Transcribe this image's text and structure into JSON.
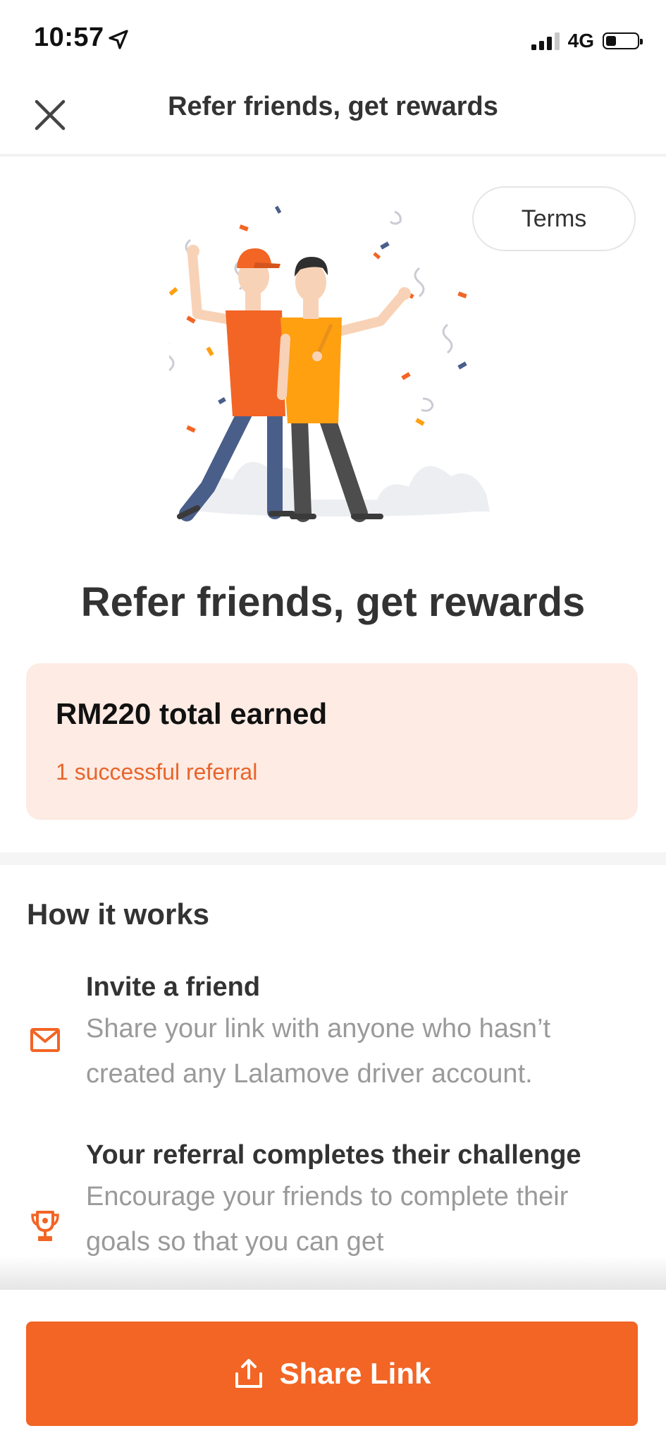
{
  "status": {
    "time": "10:57",
    "network": "4G"
  },
  "nav": {
    "title": "Refer friends, get rewards"
  },
  "terms": {
    "label": "Terms"
  },
  "hero": {
    "title": "Refer friends, get rewards"
  },
  "earnings": {
    "total": "RM220 total earned",
    "referrals": "1 successful referral"
  },
  "how": {
    "title": "How it works",
    "steps": [
      {
        "icon": "mail-icon",
        "title": "Invite a friend",
        "desc": "Share your link with anyone who hasn’t created any Lalamove driver account."
      },
      {
        "icon": "trophy-icon",
        "title": "Your referral completes their challenge",
        "desc": "Encourage your friends to complete their goals so that you can get"
      }
    ]
  },
  "share": {
    "label": "Share Link"
  },
  "colors": {
    "accent": "#f26524",
    "card_bg": "#fdebe4"
  }
}
